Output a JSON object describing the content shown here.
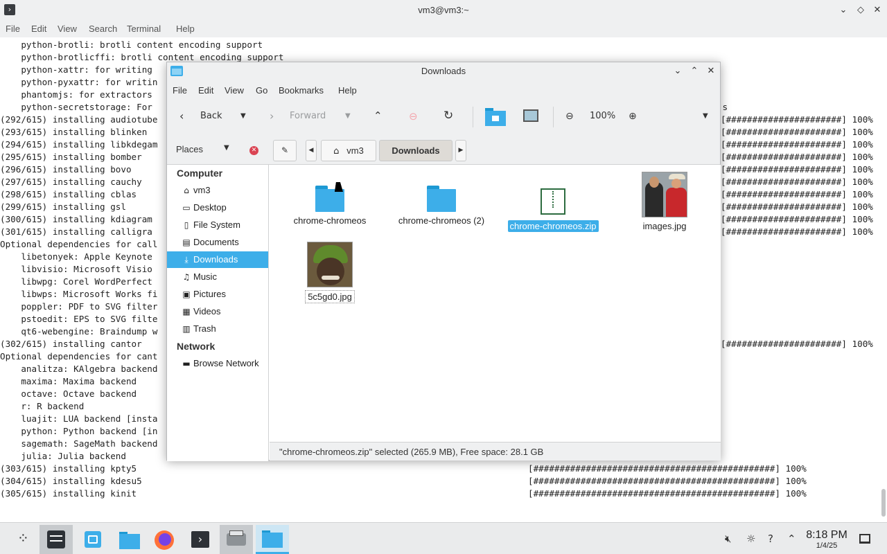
{
  "terminal": {
    "title": "vm3@vm3:~",
    "icon": "terminal-icon",
    "menu": [
      "File",
      "Edit",
      "View",
      "Search",
      "Terminal",
      "Help"
    ],
    "lines": [
      {
        "text": "    python-brotli: brotli content encoding support",
        "prog": ""
      },
      {
        "text": "    python-brotlicffi: brotli content encoding support",
        "prog": ""
      },
      {
        "text": "    python-xattr: for writing",
        "prog": ""
      },
      {
        "text": "    python-pyxattr: for writin",
        "prog": ""
      },
      {
        "text": "    phantomjs: for extractors",
        "prog": ""
      },
      {
        "text": "    python-secretstorage: For",
        "prog": "                                     s"
      },
      {
        "text": "(292/615) installing audiotube",
        "prog": "[######################] 100%"
      },
      {
        "text": "(293/615) installing blinken",
        "prog": "[######################] 100%"
      },
      {
        "text": "(294/615) installing libkdegam",
        "prog": "[######################] 100%"
      },
      {
        "text": "(295/615) installing bomber",
        "prog": "[######################] 100%"
      },
      {
        "text": "(296/615) installing bovo",
        "prog": "[######################] 100%"
      },
      {
        "text": "(297/615) installing cauchy",
        "prog": "[######################] 100%"
      },
      {
        "text": "(298/615) installing cblas",
        "prog": "[######################] 100%"
      },
      {
        "text": "(299/615) installing gsl",
        "prog": "[######################] 100%"
      },
      {
        "text": "(300/615) installing kdiagram",
        "prog": "[######################] 100%"
      },
      {
        "text": "(301/615) installing calligra",
        "prog": "[######################] 100%"
      },
      {
        "text": "Optional dependencies for call",
        "prog": ""
      },
      {
        "text": "    libetonyek: Apple Keynote",
        "prog": ""
      },
      {
        "text": "    libvisio: Microsoft Visio",
        "prog": ""
      },
      {
        "text": "    libwpg: Corel WordPerfect",
        "prog": ""
      },
      {
        "text": "    libwps: Microsoft Works fi",
        "prog": ""
      },
      {
        "text": "    poppler: PDF to SVG filter",
        "prog": ""
      },
      {
        "text": "    pstoedit: EPS to SVG filte",
        "prog": ""
      },
      {
        "text": "    qt6-webengine: Braindump w",
        "prog": ""
      },
      {
        "text": "(302/615) installing cantor",
        "prog": "[######################] 100%"
      },
      {
        "text": "Optional dependencies for cant",
        "prog": ""
      },
      {
        "text": "    analitza: KAlgebra backend",
        "prog": ""
      },
      {
        "text": "    maxima: Maxima backend",
        "prog": ""
      },
      {
        "text": "    octave: Octave backend",
        "prog": ""
      },
      {
        "text": "    r: R backend",
        "prog": ""
      },
      {
        "text": "    luajit: LUA backend [insta",
        "prog": ""
      },
      {
        "text": "    python: Python backend [in",
        "prog": ""
      },
      {
        "text": "    sagemath: SageMath backend",
        "prog": ""
      },
      {
        "text": "    julia: Julia backend",
        "prog": ""
      },
      {
        "text": "(303/615) installing kpty5",
        "prog": "[##############################################] 100%"
      },
      {
        "text": "(304/615) installing kdesu5",
        "prog": "[##############################################] 100%"
      },
      {
        "text": "(305/615) installing kinit",
        "prog": "[##############################################] 100%"
      }
    ]
  },
  "filemanager": {
    "title": "Downloads",
    "menu": [
      "File",
      "Edit",
      "View",
      "Go",
      "Bookmarks",
      "Help"
    ],
    "toolbar": {
      "back": "Back",
      "forward": "Forward",
      "zoom": "100%"
    },
    "places_label": "Places",
    "breadcrumbs": [
      "vm3",
      "Downloads"
    ],
    "sidebar": {
      "computer_heading": "Computer",
      "computer_items": [
        {
          "label": "vm3",
          "icon": "home-icon",
          "glyph": "⌂"
        },
        {
          "label": "Desktop",
          "icon": "desktop-icon",
          "glyph": "▭"
        },
        {
          "label": "File System",
          "icon": "drive-icon",
          "glyph": "▯"
        },
        {
          "label": "Documents",
          "icon": "document-icon",
          "glyph": "▤"
        },
        {
          "label": "Downloads",
          "icon": "download-icon",
          "glyph": "⤓"
        },
        {
          "label": "Music",
          "icon": "music-icon",
          "glyph": "♫"
        },
        {
          "label": "Pictures",
          "icon": "picture-icon",
          "glyph": "▣"
        },
        {
          "label": "Videos",
          "icon": "video-icon",
          "glyph": "▦"
        },
        {
          "label": "Trash",
          "icon": "trash-icon",
          "glyph": "▥"
        }
      ],
      "network_heading": "Network",
      "network_items": [
        {
          "label": "Browse Network",
          "icon": "network-icon",
          "glyph": "▬"
        }
      ]
    },
    "files": [
      {
        "name": "chrome-chromeos",
        "type": "folder"
      },
      {
        "name": "chrome-chromeos (2)",
        "type": "folder"
      },
      {
        "name": "chrome-chromeos.zip",
        "type": "zip"
      },
      {
        "name": "images.jpg",
        "type": "image"
      },
      {
        "name": "5c5gd0.jpg",
        "type": "image"
      }
    ],
    "status": "\"chrome-chromeos.zip\" selected (265.9 MB), Free space: 28.1 GB"
  },
  "taskbar": {
    "apps": [
      "app-launcher-icon",
      "settings-icon",
      "discover-store-icon",
      "file-manager-icon",
      "firefox-icon",
      "terminal-icon",
      "scanner-icon",
      "file-manager-window-icon"
    ],
    "time": "8:18 PM",
    "date": "1/4/25"
  },
  "colors": {
    "accent": "#3daee9",
    "window_bg": "#eff0f1"
  }
}
